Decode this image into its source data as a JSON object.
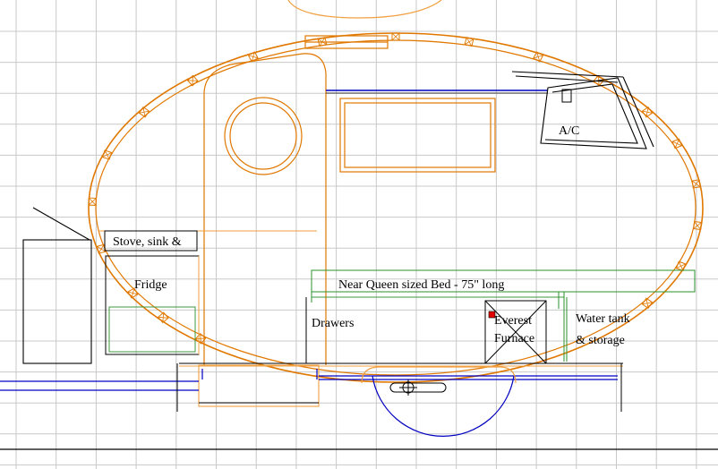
{
  "colors": {
    "grid": "#c8c8c8",
    "outline": "#e07800",
    "framing": "#f0a040",
    "equipment": "#000000",
    "frame_rail": "#0000c0",
    "bed": "#3c9a3c",
    "indicator": "#e00000",
    "background": "#ffffff"
  },
  "labels": {
    "ac": "A/C",
    "galley": "Stove, sink &",
    "fridge": "Fridge",
    "bed": "Near Queen sized Bed - 75\" long",
    "drawers": "Drawers",
    "furnace_line1": "Everest",
    "furnace_line2": "Furnace",
    "water_line1": "Water tank",
    "water_line2": "& storage"
  }
}
